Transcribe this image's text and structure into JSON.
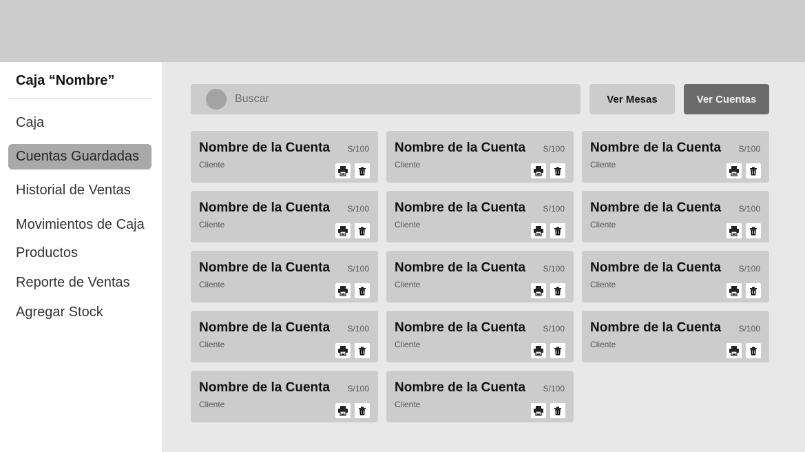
{
  "sidebar": {
    "title": "Caja “Nombre”",
    "items": [
      {
        "label": "Caja",
        "active": false
      },
      {
        "label": "Cuentas Guardadas",
        "active": true
      },
      {
        "label": "Historial de Ventas",
        "active": false
      },
      {
        "label": "Movimientos de Caja",
        "active": false
      },
      {
        "label": "Productos",
        "active": false
      },
      {
        "label": "Reporte de Ventas",
        "active": false
      },
      {
        "label": "Agregar Stock",
        "active": false
      }
    ]
  },
  "search": {
    "placeholder": "Buscar",
    "icon": "search-icon"
  },
  "buttons": {
    "mesas": "Ver Mesas",
    "cuentas": "Ver Cuentas"
  },
  "cards": [
    {
      "name": "Nombre de la Cuenta",
      "client": "Cliente",
      "price": "S/100"
    },
    {
      "name": "Nombre de la Cuenta",
      "client": "Cliente",
      "price": "S/100"
    },
    {
      "name": "Nombre de la Cuenta",
      "client": "Cliente",
      "price": "S/100"
    },
    {
      "name": "Nombre de la Cuenta",
      "client": "Cliente",
      "price": "S/100"
    },
    {
      "name": "Nombre de la Cuenta",
      "client": "Cliente",
      "price": "S/100"
    },
    {
      "name": "Nombre de la Cuenta",
      "client": "Cliente",
      "price": "S/100"
    },
    {
      "name": "Nombre de la Cuenta",
      "client": "Cliente",
      "price": "S/100"
    },
    {
      "name": "Nombre de la Cuenta",
      "client": "Cliente",
      "price": "S/100"
    },
    {
      "name": "Nombre de la Cuenta",
      "client": "Cliente",
      "price": "S/100"
    },
    {
      "name": "Nombre de la Cuenta",
      "client": "Cliente",
      "price": "S/100"
    },
    {
      "name": "Nombre de la Cuenta",
      "client": "Cliente",
      "price": "S/100"
    },
    {
      "name": "Nombre de la Cuenta",
      "client": "Cliente",
      "price": "S/100"
    },
    {
      "name": "Nombre de la Cuenta",
      "client": "Cliente",
      "price": "S/100"
    },
    {
      "name": "Nombre de la Cuenta",
      "client": "Cliente",
      "price": "S/100"
    }
  ],
  "colors": {
    "topbar": "#cccccc",
    "main_bg": "#e8e8e8",
    "card_bg": "#cccccc",
    "active_item": "#a9a9a9",
    "primary_button": "#6b6b6b"
  }
}
